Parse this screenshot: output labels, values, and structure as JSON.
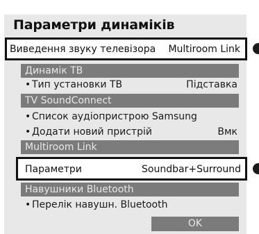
{
  "title": "Параметри динаміків",
  "output": {
    "label": "Виведення звуку телевізора",
    "value": "Multiroom Link"
  },
  "sections": [
    {
      "header": "Динамік ТВ",
      "items": [
        {
          "label": "Тип установки ТВ",
          "value": "Підставка"
        }
      ]
    },
    {
      "header": "TV SoundConnect",
      "items": [
        {
          "label": "Список аудіопристрою Samsung",
          "value": ""
        },
        {
          "label": "Додати новий пристрій",
          "value": "Вмк"
        }
      ]
    },
    {
      "header": "Multiroom Link",
      "items": [
        {
          "label": "Параметри",
          "value": "Soundbar+Surround"
        }
      ]
    },
    {
      "header": "Навушники Bluetooth",
      "items": [
        {
          "label": "Перелік навушн. Bluetooth",
          "value": ""
        }
      ]
    }
  ],
  "ok_label": "OK"
}
